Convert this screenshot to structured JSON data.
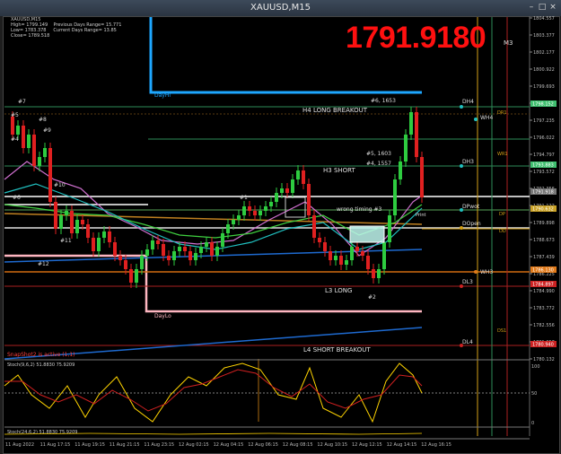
{
  "window": {
    "title": "XAUUSD,M15",
    "symbol_line": "XAUUSD,M15",
    "info_lines": [
      "High= 1799.149    Previous Days Range= 15.771",
      "Low= 1783.378     Current Days Range= 13.85",
      "Close= 1789.518"
    ],
    "big_price": "1791.9180",
    "m3_label": "M3"
  },
  "price_axis": {
    "ticks": [
      "1804.557",
      "1803.377",
      "1802.177",
      "1800.922",
      "1799.693",
      "1798.459",
      "1797.235",
      "1796.022",
      "1794.797",
      "1793.572",
      "1792.356",
      "1791.122",
      "1789.898",
      "1788.673",
      "1787.439",
      "1786.225",
      "1784.990",
      "1783.772",
      "1782.556",
      "1781.357",
      "1780.132"
    ],
    "markers": [
      {
        "text": "1798.152",
        "color": "#3fbf6f"
      },
      {
        "text": "1793.883",
        "color": "#3fbf6f"
      },
      {
        "text": "1791.918",
        "color": "#777777"
      },
      {
        "text": "1790.632",
        "color": "#c9a227"
      },
      {
        "text": "1786.130",
        "color": "#e07a1a"
      },
      {
        "text": "1784.897",
        "color": "#cc2222"
      },
      {
        "text": "1780.940",
        "color": "#cc2222"
      }
    ]
  },
  "chart_labels": {
    "dayhi": "DayHi",
    "daylo": "DayLo",
    "h4_long": "H4 LONG BREAKOUT",
    "h3_short": "H3 SHORT",
    "l3_long": "L3 LONG",
    "l4_short": "L4 SHORT BREAKOUT",
    "wrong_timing": "wrong timing #3",
    "print": "Print",
    "markers": [
      "#7",
      "#5",
      "#8",
      "#9",
      "#4",
      "#6",
      "#10",
      "#11",
      "#12",
      "#1",
      "#2",
      "#6, 1653",
      "#5, 1603",
      "#4, 1557"
    ],
    "levels_right": [
      "DH4",
      "WH4",
      "DH3",
      "DPwot",
      "DOpen",
      "WH3",
      "DL3",
      "DL4"
    ],
    "levels_far": [
      "DR1",
      "WR1",
      "DP",
      "DD",
      "DS1"
    ]
  },
  "status": {
    "snapshot": "SnapShot2 is active (1,1)",
    "stoch1": "Stoch(9,6,2) 51.8830 75.9209",
    "stoch2": "Stoch(24,6,2) 51.8830 75.9209",
    "stoch_levels": [
      "100",
      "50",
      "0"
    ]
  },
  "time_axis": [
    "11 Aug 2022",
    "11 Aug 17:15",
    "11 Aug 19:15",
    "11 Aug 21:15",
    "11 Aug 23:15",
    "12 Aug 02:15",
    "12 Aug 04:15",
    "12 Aug 06:15",
    "12 Aug 08:15",
    "12 Aug 10:15",
    "12 Aug 12:15",
    "12 Aug 14:15",
    "12 Aug 16:15"
  ]
}
